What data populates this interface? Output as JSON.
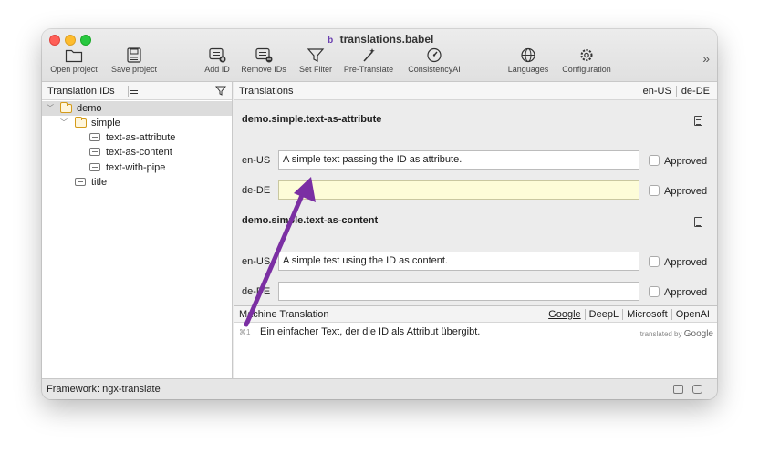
{
  "window": {
    "title": "translations.babel"
  },
  "toolbar": {
    "items": [
      {
        "label": "Open project",
        "icon": "folder-icon"
      },
      {
        "label": "Save project",
        "icon": "save-icon"
      },
      {
        "label": "Add ID",
        "icon": "add-id-icon"
      },
      {
        "label": "Remove IDs",
        "icon": "remove-id-icon"
      },
      {
        "label": "Set Filter",
        "icon": "funnel-icon"
      },
      {
        "label": "Pre-Translate",
        "icon": "magic-wand-icon"
      },
      {
        "label": "ConsistencyAI",
        "icon": "gauge-icon"
      },
      {
        "label": "Languages",
        "icon": "globe-icon"
      },
      {
        "label": "Configuration",
        "icon": "gear-icon"
      }
    ],
    "more": "»"
  },
  "sidebar": {
    "header": "Translation IDs",
    "tree": [
      {
        "label": "demo",
        "type": "folder"
      },
      {
        "label": "simple",
        "type": "folder"
      },
      {
        "label": "text-as-attribute",
        "type": "id"
      },
      {
        "label": "text-as-content",
        "type": "id"
      },
      {
        "label": "text-with-pipe",
        "type": "id"
      },
      {
        "label": "title",
        "type": "id"
      }
    ]
  },
  "main": {
    "header": "Translations",
    "languages": [
      "en-US",
      "de-DE"
    ],
    "entries": [
      {
        "id": "demo.simple.text-as-attribute",
        "rows": [
          {
            "lang": "en-US",
            "value": "A simple text passing the ID as attribute.",
            "approved_label": "Approved"
          },
          {
            "lang": "de-DE",
            "value": "",
            "approved_label": "Approved"
          }
        ]
      },
      {
        "id": "demo.simple.text-as-content",
        "rows": [
          {
            "lang": "en-US",
            "value": "A simple test using the ID as content.",
            "approved_label": "Approved"
          },
          {
            "lang": "de-DE",
            "value": "",
            "approved_label": "Approved"
          }
        ]
      }
    ]
  },
  "machine_translation": {
    "header": "Machine Translation",
    "providers": [
      "Google",
      "DeepL",
      "Microsoft",
      "OpenAI"
    ],
    "active_provider": "Google",
    "shortcut": "⌘1",
    "suggestion": "Ein einfacher Text, der die ID als Attribut übergibt.",
    "credit_prefix": "translated by",
    "credit_brand": "Google"
  },
  "statusbar": {
    "framework": "Framework: ngx-translate"
  },
  "colors": {
    "active_field": "#fdfcd8",
    "arrow": "#7b2fa3",
    "folder": "#d49b1a"
  }
}
